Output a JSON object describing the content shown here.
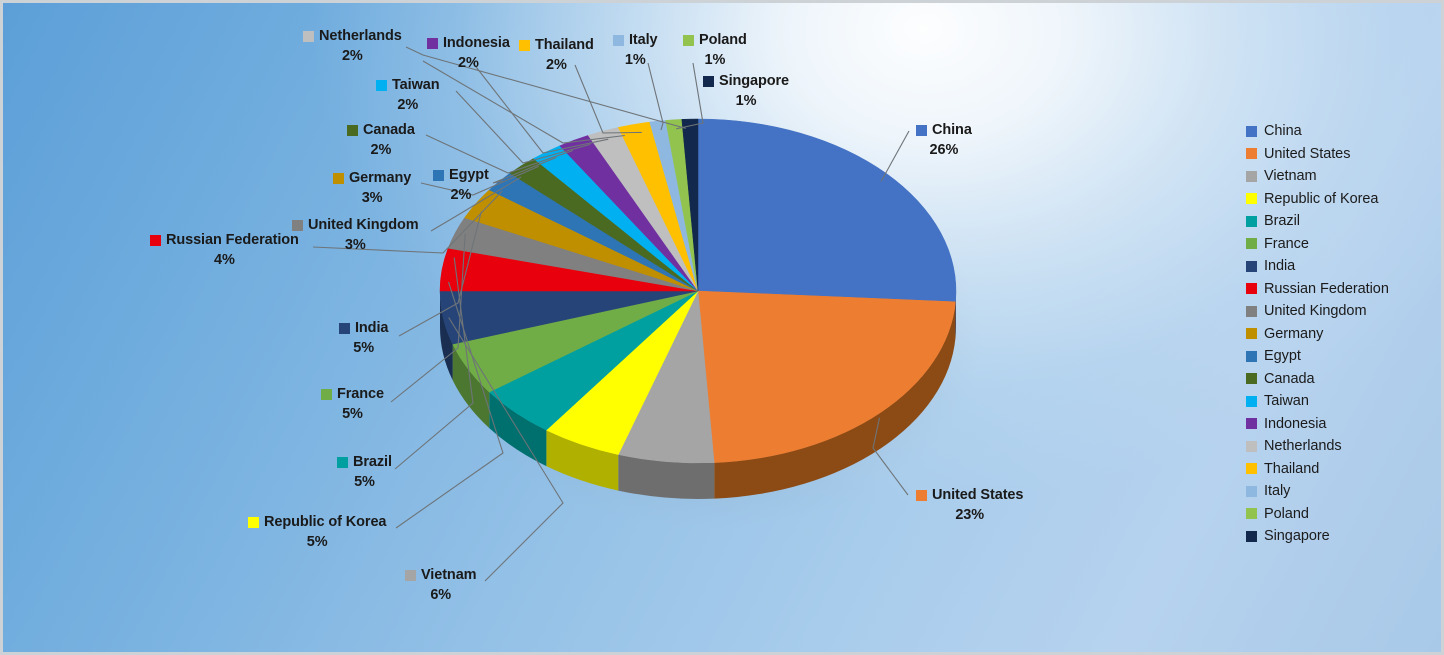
{
  "chart_data": {
    "type": "pie",
    "title": "",
    "subtitle": "",
    "xlabel": "",
    "ylabel": "",
    "legend_position": "right",
    "three_d": true,
    "grid": false,
    "categories": [
      "China",
      "United States",
      "Vietnam",
      "Republic of Korea",
      "Brazil",
      "France",
      "India",
      "Russian Federation",
      "United Kingdom",
      "Germany",
      "Egypt",
      "Canada",
      "Taiwan",
      "Indonesia",
      "Netherlands",
      "Thailand",
      "Italy",
      "Poland",
      "Singapore"
    ],
    "values": [
      26,
      23,
      6,
      5,
      5,
      5,
      5,
      4,
      3,
      3,
      2,
      2,
      2,
      2,
      2,
      2,
      1,
      1,
      1
    ],
    "value_labels": [
      "26%",
      "23%",
      "6%",
      "5%",
      "5%",
      "5%",
      "5%",
      "4%",
      "3%",
      "3%",
      "2%",
      "2%",
      "2%",
      "2%",
      "2%",
      "2%",
      "1%",
      "1%",
      "1%"
    ],
    "colors": [
      "#4472C4",
      "#ED7D31",
      "#A5A5A5",
      "#FFFF00",
      "#00A0A0",
      "#70AD47",
      "#264478",
      "#E8000D",
      "#808080",
      "#BF8F00",
      "#2E75B6",
      "#4A6A22",
      "#00B0F0",
      "#7030A0",
      "#BFBFBF",
      "#FFC000",
      "#8FB8E0",
      "#93C34F",
      "#12284C"
    ],
    "side_colors": [
      "#2B4C8C",
      "#8C4B15",
      "#6E6E6E",
      "#B0B000",
      "#00706E",
      "#4C7731",
      "#1A2E51",
      "#A00008",
      "#595959",
      "#856300",
      "#1F5282",
      "#33491A",
      "#0079A6",
      "#4D2170",
      "#858585",
      "#B08500",
      "#63809B",
      "#678C37",
      "#0B1A31"
    ]
  },
  "labels": [
    {
      "name": "Netherlands",
      "pct": "2%",
      "color": "#BFBFBF"
    },
    {
      "name": "Indonesia",
      "pct": "2%",
      "color": "#7030A0"
    },
    {
      "name": "Thailand",
      "pct": "2%",
      "color": "#FFC000"
    },
    {
      "name": "Italy",
      "pct": "1%",
      "color": "#8FB8E0"
    },
    {
      "name": "Poland",
      "pct": "1%",
      "color": "#93C34F"
    },
    {
      "name": "Singapore",
      "pct": "1%",
      "color": "#12284C"
    },
    {
      "name": "Taiwan",
      "pct": "2%",
      "color": "#00B0F0"
    },
    {
      "name": "Canada",
      "pct": "2%",
      "color": "#4A6A22"
    },
    {
      "name": "Germany",
      "pct": "3%",
      "color": "#BF8F00"
    },
    {
      "name": "Egypt",
      "pct": "2%",
      "color": "#2E75B6"
    },
    {
      "name": "United Kingdom",
      "pct": "3%",
      "color": "#808080"
    },
    {
      "name": "Russian Federation",
      "pct": "4%",
      "color": "#E8000D"
    },
    {
      "name": "India",
      "pct": "5%",
      "color": "#264478"
    },
    {
      "name": "France",
      "pct": "5%",
      "color": "#70AD47"
    },
    {
      "name": "Brazil",
      "pct": "5%",
      "color": "#00A0A0"
    },
    {
      "name": "Republic of Korea",
      "pct": "5%",
      "color": "#FFFF00"
    },
    {
      "name": "Vietnam",
      "pct": "6%",
      "color": "#A5A5A5"
    },
    {
      "name": "China",
      "pct": "26%",
      "color": "#4472C4"
    },
    {
      "name": "United States",
      "pct": "23%",
      "color": "#ED7D31"
    }
  ],
  "legend": {
    "items": [
      {
        "label": "China",
        "color": "#4472C4"
      },
      {
        "label": "United States",
        "color": "#ED7D31"
      },
      {
        "label": "Vietnam",
        "color": "#A5A5A5"
      },
      {
        "label": "Republic of Korea",
        "color": "#FFFF00"
      },
      {
        "label": "Brazil",
        "color": "#00A0A0"
      },
      {
        "label": "France",
        "color": "#70AD47"
      },
      {
        "label": "India",
        "color": "#264478"
      },
      {
        "label": "Russian Federation",
        "color": "#E8000D"
      },
      {
        "label": "United Kingdom",
        "color": "#808080"
      },
      {
        "label": "Germany",
        "color": "#BF8F00"
      },
      {
        "label": "Egypt",
        "color": "#2E75B6"
      },
      {
        "label": "Canada",
        "color": "#4A6A22"
      },
      {
        "label": "Taiwan",
        "color": "#00B0F0"
      },
      {
        "label": "Indonesia",
        "color": "#7030A0"
      },
      {
        "label": "Netherlands",
        "color": "#BFBFBF"
      },
      {
        "label": "Thailand",
        "color": "#FFC000"
      },
      {
        "label": "Italy",
        "color": "#8FB8E0"
      },
      {
        "label": "Poland",
        "color": "#93C34F"
      },
      {
        "label": "Singapore",
        "color": "#12284C"
      }
    ]
  }
}
